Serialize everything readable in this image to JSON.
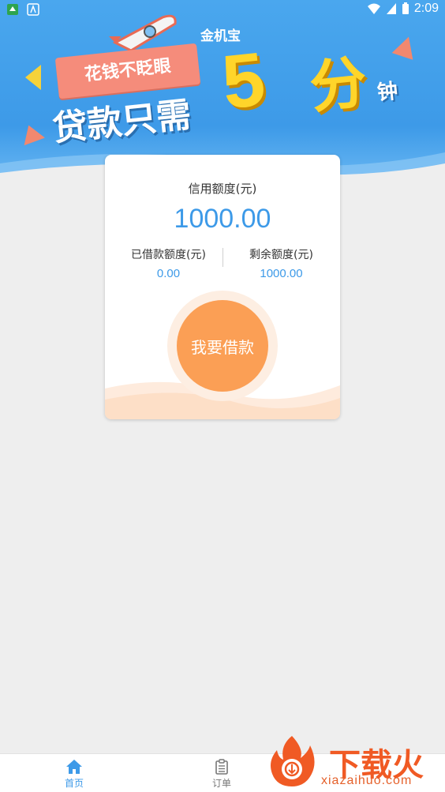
{
  "status_bar": {
    "time": "2:09"
  },
  "banner": {
    "app_name": "金机宝",
    "slogan": "花钱不眨眼",
    "headline": "贷款只需",
    "big_number": "5",
    "big_number_unit": "分",
    "unit_suffix": "钟"
  },
  "card": {
    "credit_label": "信用额度(元)",
    "credit_value": "1000.00",
    "borrowed_label": "已借款额度(元)",
    "borrowed_value": "0.00",
    "remaining_label": "剩余额度(元)",
    "remaining_value": "1000.00",
    "borrow_button": "我要借款"
  },
  "bottom_nav": {
    "items": [
      {
        "label": "首页",
        "icon": "home-icon",
        "active": true
      },
      {
        "label": "订单",
        "icon": "clipboard-icon",
        "active": false
      }
    ]
  },
  "watermark": {
    "text": "下载火",
    "url": "xiazaihuo.com"
  },
  "colors": {
    "primary": "#3d9ae8",
    "accent_orange": "#fb9f55",
    "background": "#eeeeee",
    "watermark": "#f05a24"
  }
}
